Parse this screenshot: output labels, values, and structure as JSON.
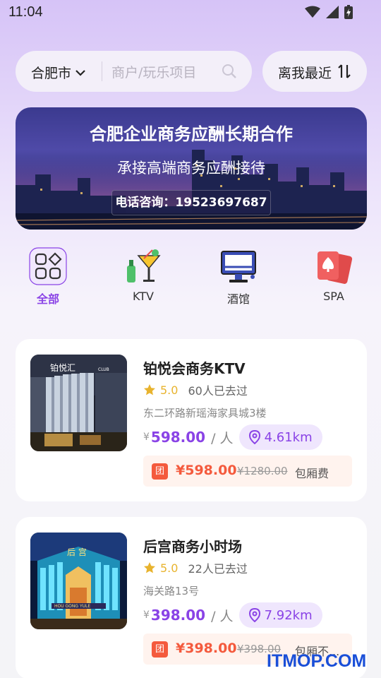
{
  "status_bar": {
    "time": "11:04"
  },
  "search": {
    "city": "合肥市",
    "placeholder": "商户/玩乐项目",
    "sort_label": "离我最近"
  },
  "banner": {
    "title": "合肥企业商务应酬长期合作",
    "subtitle": "承接高端商务应酬接待",
    "phone": "电话咨询：19523697687"
  },
  "categories": [
    {
      "label": "全部",
      "icon": "grid-icon",
      "active": true
    },
    {
      "label": "KTV",
      "icon": "cocktail-icon",
      "active": false
    },
    {
      "label": "酒馆",
      "icon": "monitor-icon",
      "active": false
    },
    {
      "label": "SPA",
      "icon": "cards-icon",
      "active": false
    }
  ],
  "listings": [
    {
      "title": "铂悦会商务KTV",
      "rating": "5.0",
      "visits": "60人已去过",
      "address": "东二环路新瑶海家具城3楼",
      "price_yen": "¥",
      "price": "598.00",
      "per": "/ 人",
      "distance": "4.61km",
      "deal_badge": "团",
      "deal_price": "¥598.00",
      "deal_old": "¥1280.00",
      "deal_desc": "包厢费",
      "image_sign": "铂悦汇"
    },
    {
      "title": "后宫商务小时场",
      "rating": "5.0",
      "visits": "22人已去过",
      "address": "海关路13号",
      "price_yen": "¥",
      "price": "398.00",
      "per": "/ 人",
      "distance": "7.92km",
      "deal_badge": "团",
      "deal_price": "¥398.00",
      "deal_old": "¥398.00",
      "deal_desc": "包厢不...",
      "image_sign": "后 宫"
    }
  ],
  "watermark": "ITMOP.COM",
  "colors": {
    "accent": "#8a43e6",
    "deal": "#f45a3d",
    "star": "#e8b32e"
  }
}
